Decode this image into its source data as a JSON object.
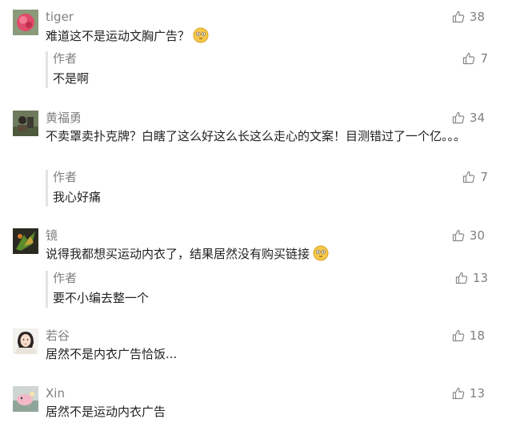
{
  "comments": [
    {
      "name": "tiger",
      "text": "难道这不是运动文胸广告？",
      "likes": "38",
      "emoji": "flushed-face-icon",
      "reply": {
        "name": "作者",
        "text": "不是啊",
        "likes": "7"
      }
    },
    {
      "name": "黄福勇",
      "text": "不卖罩卖扑克牌？白瞎了这么好这么长这么走心的文案！目测错过了一个亿。。。",
      "likes": "34",
      "reply": {
        "name": "作者",
        "text": "我心好痛",
        "likes": "7"
      }
    },
    {
      "name": "镜",
      "text": "说得我都想买运动内衣了，结果居然没有购买链接",
      "likes": "30",
      "emoji": "flushed-face-icon",
      "reply": {
        "name": "作者",
        "text": "要不小编去整一个",
        "likes": "13"
      }
    },
    {
      "name": "若谷",
      "text": "居然不是内衣广告恰饭...",
      "likes": "18"
    },
    {
      "name": "Xin",
      "text": "居然不是运动内衣广告",
      "likes": "13"
    }
  ],
  "colors": {
    "meta": "#808080",
    "text": "#222222",
    "reply_bar": "#e4e4e4"
  }
}
